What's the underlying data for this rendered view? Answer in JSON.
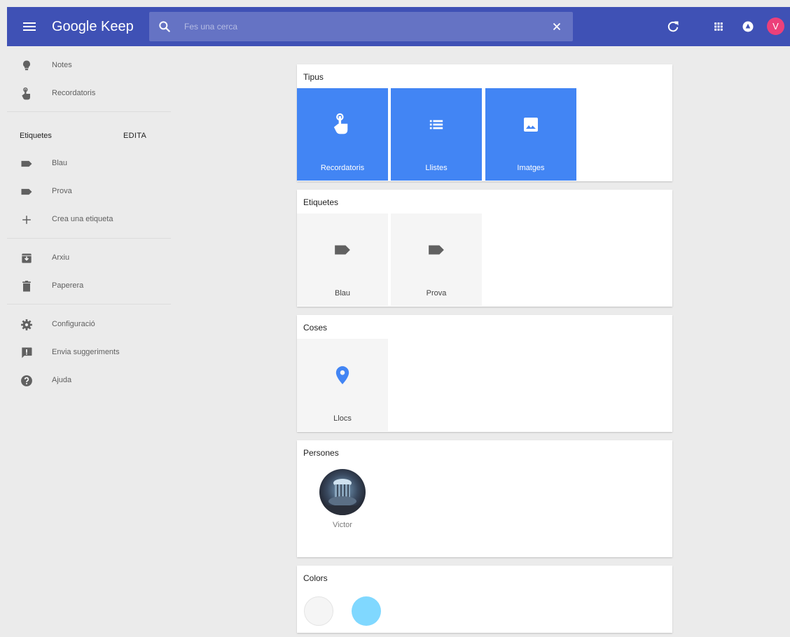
{
  "header": {
    "app_title": "Google Keep",
    "search": {
      "placeholder": "Fes una cerca",
      "value": ""
    },
    "icons": [
      "menu-icon",
      "search-icon",
      "close-icon",
      "refresh-icon",
      "apps-icon",
      "notifications-icon"
    ],
    "avatar_initial": "V",
    "colors": {
      "bar": "#3f51b5",
      "search": "#6573c4",
      "avatar": "#ec407a"
    }
  },
  "sidebar": {
    "notes_label": "Notes",
    "reminders_label": "Recordatoris",
    "labels_heading": "Etiquetes",
    "edit_label": "EDITA",
    "labels": [
      "Blau",
      "Prova"
    ],
    "create_label": "Crea una etiqueta",
    "archive_label": "Arxiu",
    "trash_label": "Paperera",
    "settings_label": "Configuració",
    "feedback_label": "Envia suggeriments",
    "help_label": "Ajuda"
  },
  "main": {
    "types": {
      "title": "Tipus",
      "items": [
        "Recordatoris",
        "Llistes",
        "Imatges"
      ],
      "color": "#4285f4"
    },
    "labels": {
      "title": "Etiquetes",
      "items": [
        "Blau",
        "Prova"
      ]
    },
    "things": {
      "title": "Coses",
      "items": [
        "Llocs"
      ]
    },
    "people": {
      "title": "Persones",
      "items": [
        "Victor"
      ]
    },
    "colors": {
      "title": "Colors",
      "swatches": [
        "#f5f5f5",
        "#80d8ff"
      ]
    }
  }
}
